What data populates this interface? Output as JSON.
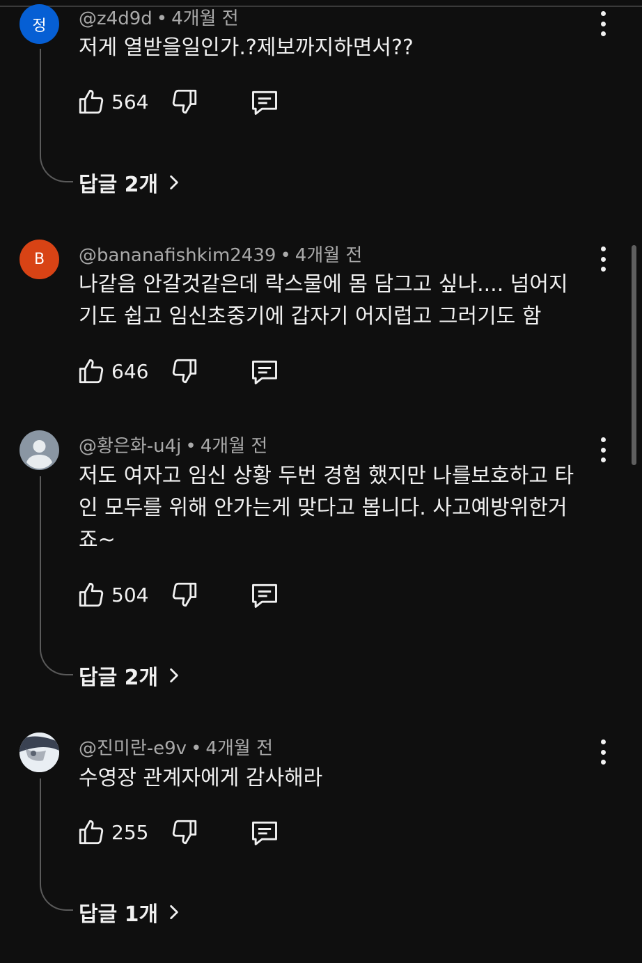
{
  "comments": [
    {
      "avatar": {
        "kind": "letter",
        "text": "정",
        "color": "#065fd4"
      },
      "author": "@z4d9d",
      "time": "4개월 전",
      "text_lines": [
        "저게 열받을일인가.?제보까지하면서??"
      ],
      "likes": "564",
      "replies_label": "답글 2개"
    },
    {
      "avatar": {
        "kind": "letter",
        "text": "B",
        "color": "#d84315"
      },
      "author": "@bananafishkim2439",
      "time": "4개월 전",
      "text_lines": [
        "나같음 안갈것같은데 락스물에 몸 담그고 싶나.... 넘어지",
        "기도 쉽고 임신초중기에 갑자기 어지럽고 그러기도 함"
      ],
      "likes": "646",
      "replies_label": ""
    },
    {
      "avatar": {
        "kind": "default",
        "text": "",
        "color": "#8a96a3"
      },
      "author": "@황은화-u4j",
      "time": "4개월 전",
      "text_lines": [
        "저도 여자고 임신 상황 두번 경험 했지만 나를보호하고 타",
        "인 모두를 위해 안가는게 맞다고 봅니다. 사고예방위한거",
        "죠~"
      ],
      "likes": "504",
      "replies_label": "답글 2개"
    },
    {
      "avatar": {
        "kind": "photo",
        "text": "",
        "color": "#c9d2dc"
      },
      "author": "@진미란-e9v",
      "time": "4개월 전",
      "text_lines": [
        "수영장 관계자에게 감사해라"
      ],
      "likes": "255",
      "replies_label": "답글 1개"
    }
  ],
  "icons": {
    "like": "thumbs-up-icon",
    "dislike": "thumbs-down-icon",
    "reply": "reply-comment-icon",
    "more": "more-vertical-icon",
    "chevron": "chevron-right-icon"
  },
  "colors": {
    "background": "#0f0f0f",
    "text_primary": "#f1f1f1",
    "text_secondary": "#aaaaaa",
    "thread_line": "#5a5a5a"
  }
}
